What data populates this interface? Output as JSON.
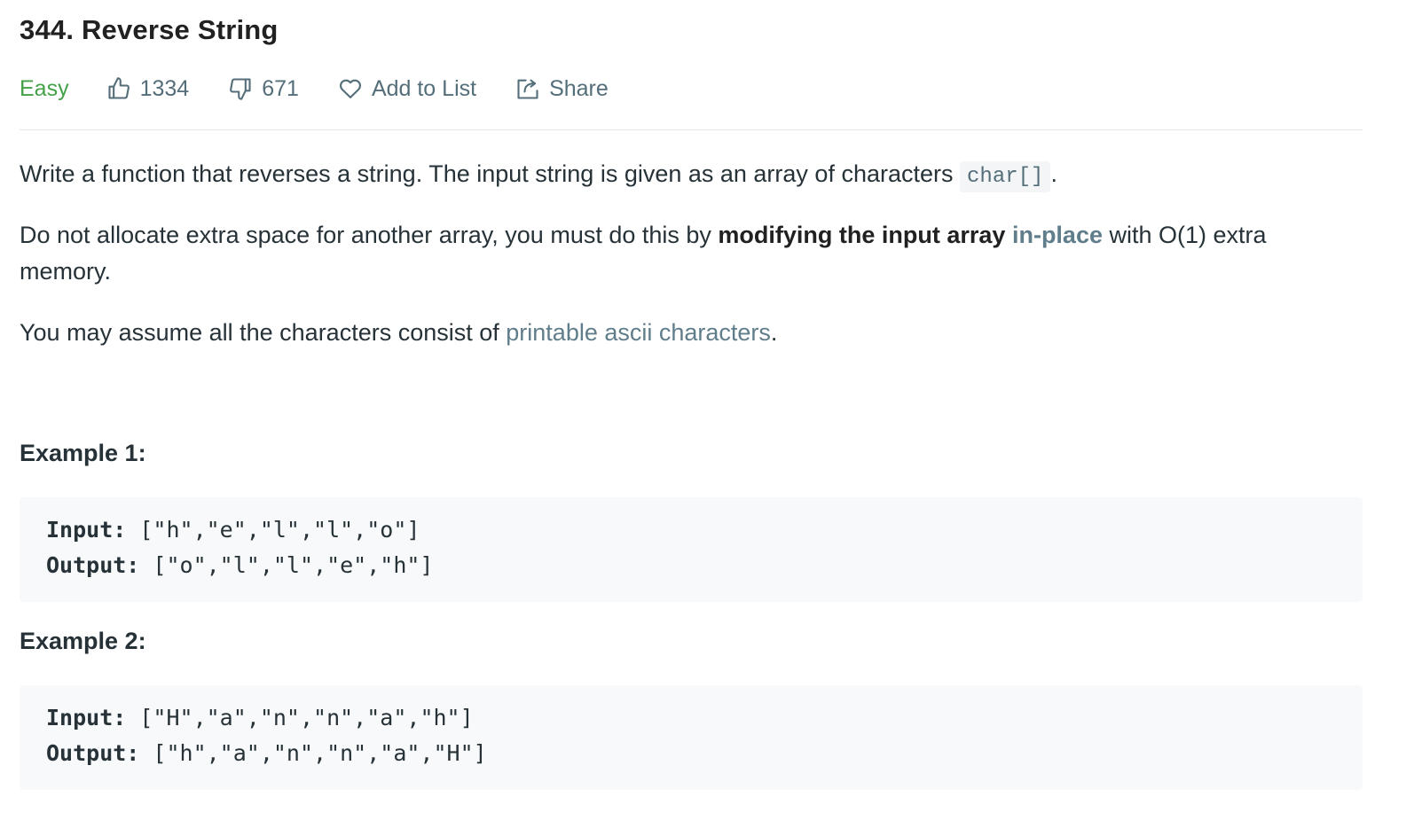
{
  "problem": {
    "title": "344. Reverse String",
    "difficulty": "Easy",
    "likes": "1334",
    "dislikes": "671",
    "add_to_list_label": "Add to List",
    "share_label": "Share"
  },
  "description": {
    "p1_text": "Write a function that reverses a string. The input string is given as an array of characters ",
    "p1_code": "char[]",
    "p1_end": ".",
    "p2_text": "Do not allocate extra space for another array, you must do this by ",
    "p2_bold": "modifying the input array",
    "p2_link": "in-place",
    "p2_end": " with O(1) extra memory.",
    "p3_text": "You may assume all the characters consist of ",
    "p3_link": "printable ascii characters",
    "p3_end": "."
  },
  "examples": [
    {
      "heading": "Example 1:",
      "input_label": "Input:",
      "input_value": " [\"h\",\"e\",\"l\",\"l\",\"o\"]",
      "output_label": "Output:",
      "output_value": " [\"o\",\"l\",\"l\",\"e\",\"h\"]"
    },
    {
      "heading": "Example 2:",
      "input_label": "Input:",
      "input_value": " [\"H\",\"a\",\"n\",\"n\",\"a\",\"h\"]",
      "output_label": "Output:",
      "output_value": " [\"h\",\"a\",\"n\",\"n\",\"a\",\"H\"]"
    }
  ],
  "icons": {
    "like": "thumbs-up-icon",
    "dislike": "thumbs-down-icon",
    "add_to_list": "heart-icon",
    "share": "share-icon"
  },
  "colors": {
    "easy": "#43a047",
    "link": "#607d8b",
    "meta_text": "#546e7a",
    "code_bg": "#f7f9fa"
  }
}
